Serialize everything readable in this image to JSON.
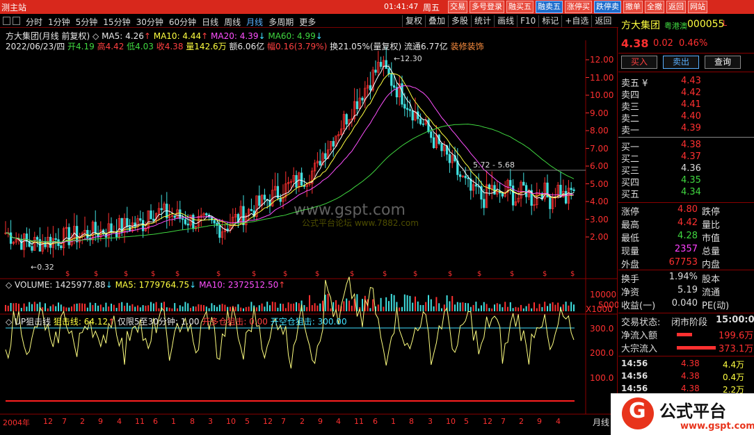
{
  "topbar": {
    "app_title": "测主站",
    "clock": "01:41:47",
    "weekday": "周五",
    "buttons": [
      "交易",
      "多号登录",
      "融买五",
      "融卖五",
      "涨停买",
      "跌停卖",
      "撤单",
      "全撤",
      "返回",
      "网站"
    ]
  },
  "period_tabs": [
    "分时",
    "1分钟",
    "5分钟",
    "15分钟",
    "30分钟",
    "60分钟",
    "日线",
    "周线",
    "月线",
    "多周期",
    "更多"
  ],
  "tool_tabs": [
    "复权",
    "叠加",
    "多股",
    "统计",
    "画线",
    "F10",
    "标记",
    "+自选",
    "返回"
  ],
  "chart": {
    "info1": {
      "name": "方大集团(月线 前复权)",
      "ma5": "MA5: 4.26",
      "ma10": "MA10: 4.44",
      "ma20": "MA20: 4.39",
      "ma60": "MA60: 4.99"
    },
    "info2": {
      "date": "2022/06/23/四",
      "open": "开4.19",
      "high": "高4.42",
      "low": "低4.03",
      "close": "收4.38",
      "volume": "量142.6万",
      "amount": "额6.06亿",
      "range": "幅0.16(3.79%)",
      "turnover": "换21.05%(量复权)",
      "float": "流通6.77亿",
      "industry": "装修装饰"
    },
    "annot_high": "12.30",
    "annot_low": "0.32",
    "annot_level": "5.72 - 5.68",
    "price_axis": [
      "12.00",
      "11.00",
      "10.00",
      "9.00",
      "8.00",
      "7.00",
      "6.00",
      "5.00",
      "4.00",
      "3.00",
      "2.00"
    ],
    "volume_header": {
      "volume": "VOLUME: 1425977.88",
      "ma5": "MA5: 1779764.75",
      "ma10": "MA10: 2372512.50"
    },
    "volume_axis": [
      "10000",
      "5000",
      "X1000"
    ],
    "indicator_header": {
      "name": "UP狙击线",
      "snipe": "狙击线: 64.12",
      "period_only": "仅限5至30分钟: 1.00",
      "open_long": "开多仓狙击: 0.00",
      "open_short": "开空仓狙击: 300.00"
    },
    "indicator_axis": [
      "300.0",
      "200.0",
      "100.0"
    ],
    "months": [
      "2004年",
      "12",
      "7",
      "2",
      "9",
      "4",
      "11",
      "6",
      "1",
      "8",
      "3",
      "10",
      "5",
      "12",
      "7",
      "2",
      "9",
      "4",
      "11",
      "6",
      "1",
      "8",
      "3",
      "10",
      "5",
      "12",
      "7",
      "2",
      "9",
      "4"
    ],
    "period_name": "月线",
    "watermark": "www.gspt.com",
    "watermark_sub": "公式平台论坛 www.7882.com"
  },
  "quote": {
    "name": "方大集团",
    "sub": "粤港澳",
    "code": "000055",
    "mark": "L",
    "price": "4.38",
    "change": "0.02",
    "change_pct": "0.46%",
    "buttons": [
      "买入",
      "卖出",
      "查询"
    ],
    "sell_orders": [
      {
        "label": "卖五 ¥",
        "price": "4.43"
      },
      {
        "label": "卖四",
        "price": "4.42"
      },
      {
        "label": "卖三",
        "price": "4.41"
      },
      {
        "label": "卖二",
        "price": "4.40"
      },
      {
        "label": "卖一",
        "price": "4.39"
      }
    ],
    "buy_orders": [
      {
        "label": "买一",
        "price": "4.38"
      },
      {
        "label": "买二",
        "price": "4.37"
      },
      {
        "label": "买三",
        "price": "4.36"
      },
      {
        "label": "买四",
        "price": "4.35"
      },
      {
        "label": "买五",
        "price": "4.34"
      }
    ],
    "stats": [
      {
        "l": "涨停",
        "v": "4.80",
        "r": "跌停",
        "color": "#ff3030"
      },
      {
        "l": "最高",
        "v": "4.42",
        "r": "量比",
        "color": "#ff3030"
      },
      {
        "l": "最低",
        "v": "4.28",
        "r": "市值",
        "color": "#40d840"
      },
      {
        "l": "现量",
        "v": "2357",
        "r": "总量",
        "color": "#ff40ff"
      },
      {
        "l": "外盘",
        "v": "67753",
        "r": "内盘",
        "color": "#ff3030"
      }
    ],
    "stats2": [
      {
        "l": "换手",
        "v": "1.94%",
        "r": "股本"
      },
      {
        "l": "净资",
        "v": "5.19",
        "r": "流通"
      },
      {
        "l": "收益(一)",
        "v": "0.040",
        "r": "PE(动)"
      }
    ],
    "trade_status_label": "交易状态:",
    "trade_status": "闭市阶段",
    "trade_time": "15:00:0",
    "net_inflow_label": "净流入额",
    "net_inflow": "199.6万",
    "block_inflow_label": "大宗流入",
    "block_inflow": "373.1万",
    "ticks": [
      {
        "t": "14:56",
        "p": "4.38",
        "v": "4.4万"
      },
      {
        "t": "14:56",
        "p": "4.38",
        "v": "0.4万"
      },
      {
        "t": "14:56",
        "p": "4.38",
        "v": "2.2万"
      }
    ]
  },
  "logo": {
    "title": "公式平台",
    "url": "www.gspt.com"
  },
  "colors": {
    "up": "#ff3030",
    "down": "#40e0e0",
    "ma5": "#ffffff",
    "ma10": "#ffff40",
    "ma20": "#ff50ff",
    "ma60": "#40d840"
  }
}
